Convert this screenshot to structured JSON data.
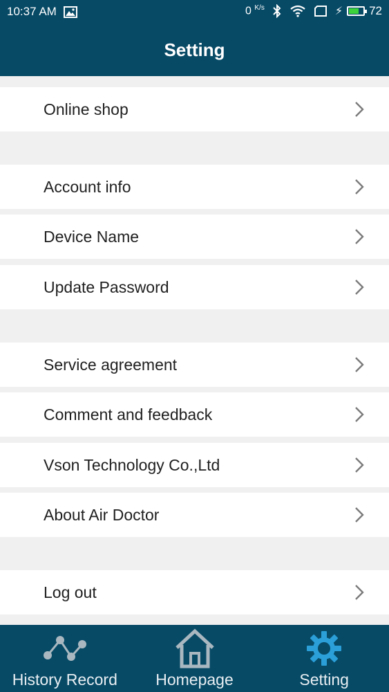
{
  "status_bar": {
    "time": "10:37 AM",
    "net_speed": "0",
    "net_unit": "K/s",
    "battery": "72",
    "battery_level": 0.72
  },
  "header": {
    "title": "Setting"
  },
  "menu": {
    "items": [
      {
        "label": "Online shop"
      },
      {
        "label": "Account info"
      },
      {
        "label": "Device Name"
      },
      {
        "label": "Update Password"
      },
      {
        "label": "Service agreement"
      },
      {
        "label": "Comment and feedback"
      },
      {
        "label": "Vson Technology Co.,Ltd"
      },
      {
        "label": "About Air Doctor"
      },
      {
        "label": "Log out"
      }
    ]
  },
  "tabs": [
    {
      "label": "History Record",
      "icon": "chart-line-icon"
    },
    {
      "label": "Homepage",
      "icon": "home-icon"
    },
    {
      "label": "Setting",
      "icon": "gear-icon",
      "active": true
    }
  ],
  "colors": {
    "primary": "#074a66",
    "active_icon": "#2a9fd8",
    "inactive_icon": "#a9b8c0",
    "background": "#f0f0f0",
    "battery_fill": "#3bd23b"
  }
}
